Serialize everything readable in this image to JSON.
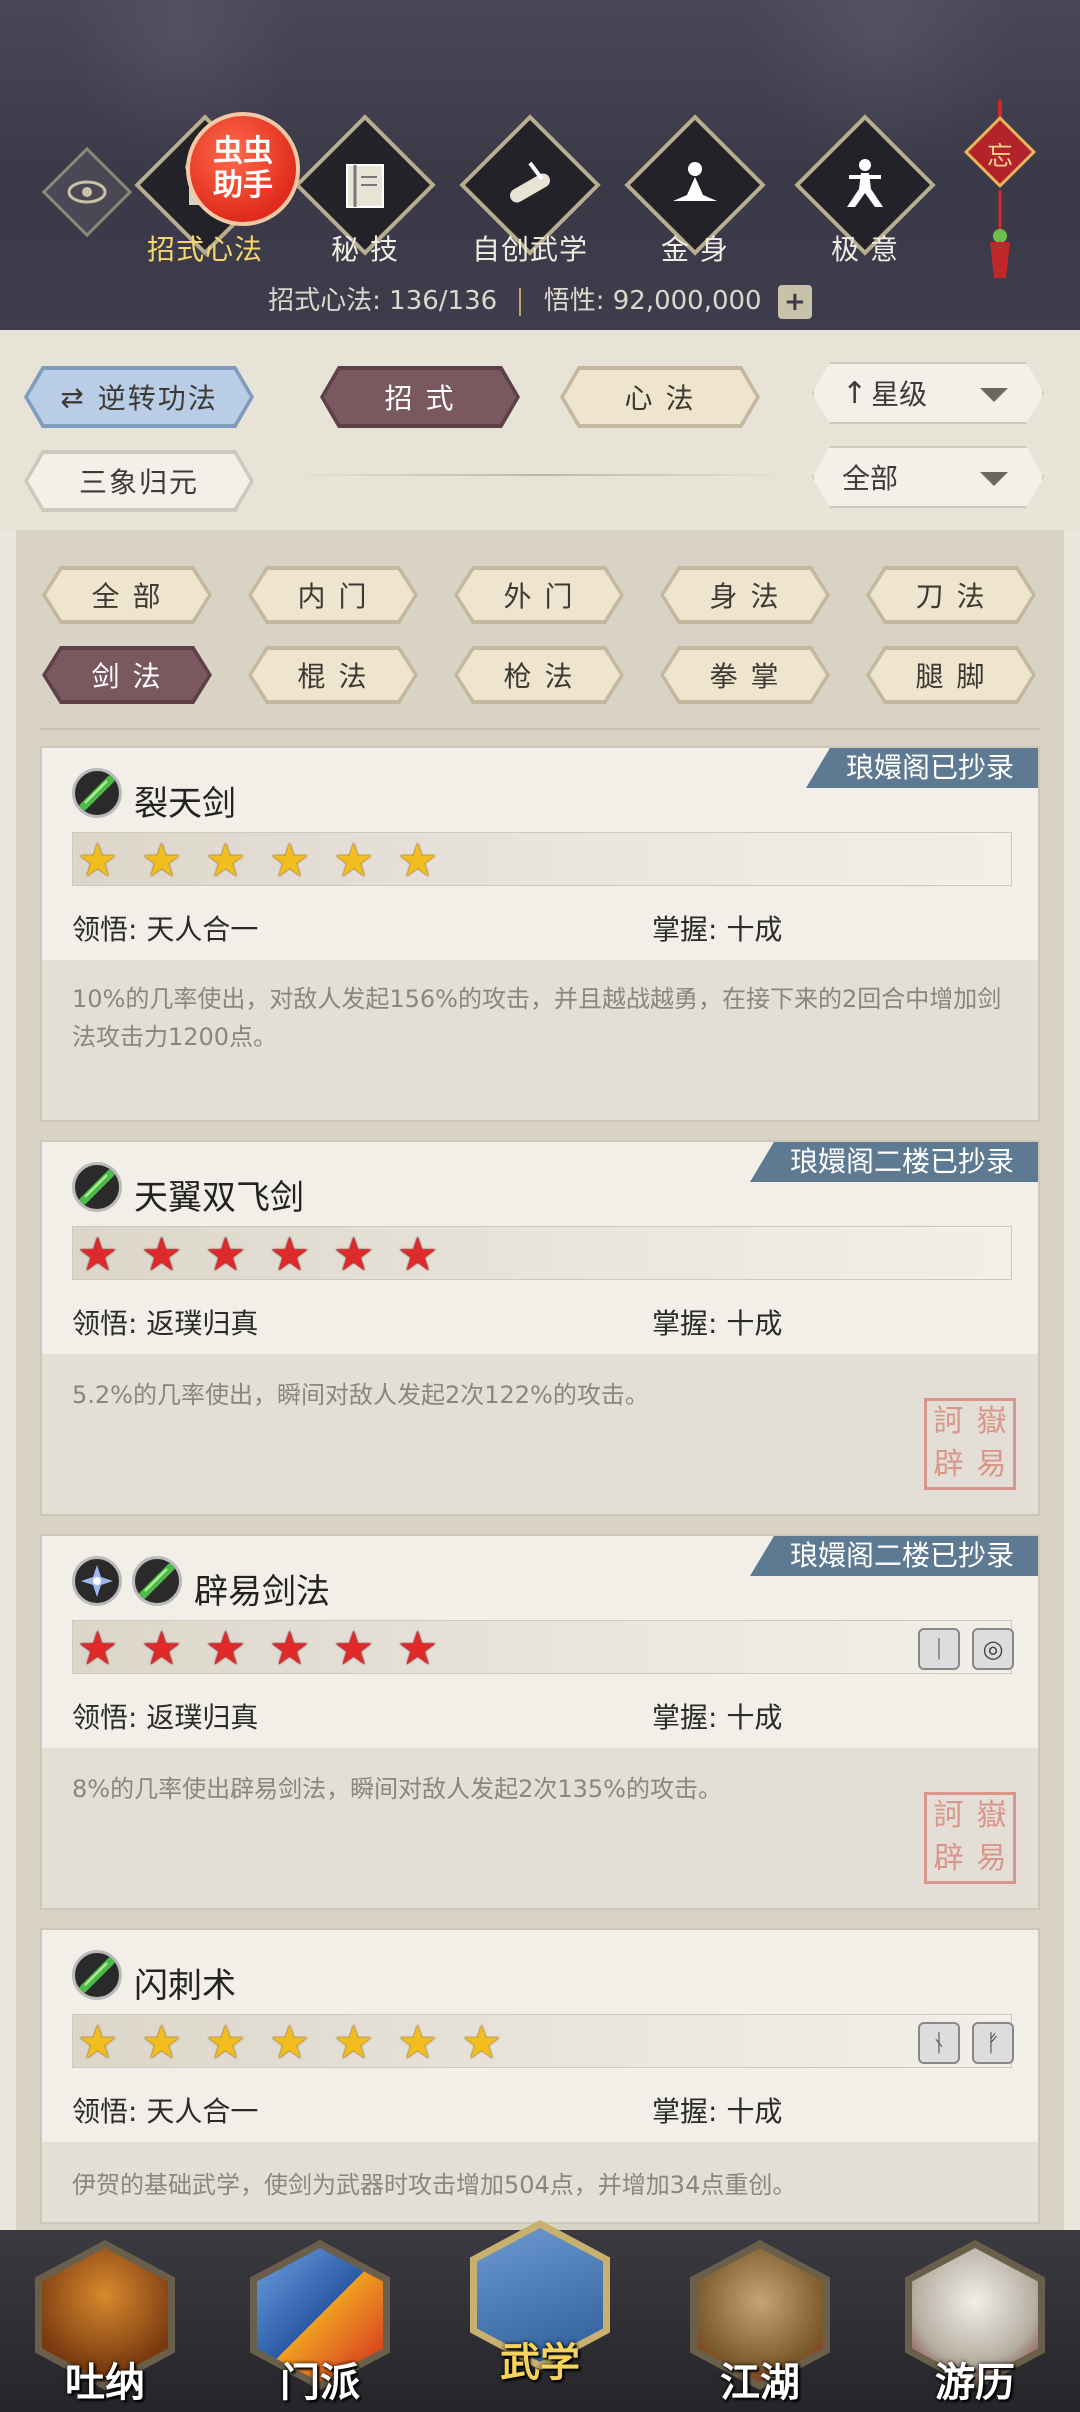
{
  "header": {
    "tabs": [
      {
        "label": "招式心法",
        "icon": "scroll-icon",
        "active": true
      },
      {
        "label": "秘 技",
        "icon": "book-icon"
      },
      {
        "label": "自创武学",
        "icon": "brush-scroll-icon"
      },
      {
        "label": "金 身",
        "icon": "meditation-icon"
      },
      {
        "label": "极 意",
        "icon": "martial-stance-icon"
      }
    ],
    "badge_text": "虫虫\n助手",
    "stats": {
      "skills_label": "招式心法:",
      "skills_value": "136/136",
      "insight_label": "悟性:",
      "insight_value": "92,000,000",
      "plus": "+"
    },
    "knot_char": "忘"
  },
  "toolbar": {
    "reverse_label": "逆转功法",
    "tab_moves": "招 式",
    "tab_mind": "心 法",
    "sort_select": "星级",
    "sanxiang_label": "三象归元",
    "filter_select": "全部"
  },
  "filters": {
    "row1": [
      "全 部",
      "内 门",
      "外 门",
      "身 法",
      "刀 法"
    ],
    "row2": [
      "剑 法",
      "棍 法",
      "枪 法",
      "拳 掌",
      "腿 脚"
    ],
    "active": "剑 法"
  },
  "cards": [
    {
      "title": "裂天剑",
      "tag": "琅嬛阁已抄录",
      "star_color": "gold",
      "stars": 6,
      "insight_label": "领悟:",
      "insight_value": "天人合一",
      "mastery_label": "掌握:",
      "mastery_value": "十成",
      "desc": "10%的几率使出，对敌人发起156%的攻击，并且越战越勇，在接下来的2回合中增加剑法攻击力1200点。"
    },
    {
      "title": "天翼双飞剑",
      "tag": "琅嬛阁二楼已抄录",
      "star_color": "red",
      "stars": 6,
      "insight_label": "领悟:",
      "insight_value": "返璞归真",
      "mastery_label": "掌握:",
      "mastery_value": "十成",
      "desc": "5.2%的几率使出，瞬间对敌人发起2次122%的攻击。",
      "seal": [
        "訶",
        "嶽",
        "辟",
        "易"
      ]
    },
    {
      "title": "辟易剑法",
      "tag": "琅嬛阁二楼已抄录",
      "star_color": "red",
      "stars": 6,
      "insight_label": "领悟:",
      "insight_value": "返璞归真",
      "mastery_label": "掌握:",
      "mastery_value": "十成",
      "desc": "8%的几率使出辟易剑法，瞬间对敌人发起2次135%的攻击。",
      "seal": [
        "訶",
        "嶽",
        "辟",
        "易"
      ]
    },
    {
      "title": "闪刺术",
      "star_color": "gold",
      "stars": 7,
      "insight_label": "领悟:",
      "insight_value": "天人合一",
      "mastery_label": "掌握:",
      "mastery_value": "十成",
      "desc": "伊贺的基础武学，使剑为武器时攻击增加504点，并增加34点重创。"
    }
  ],
  "bottom_nav": [
    {
      "label": "吐纳",
      "icon": "monk-icon"
    },
    {
      "label": "门派",
      "icon": "sect-flags-icon"
    },
    {
      "label": "武学",
      "icon": "martial-books-icon",
      "active": true
    },
    {
      "label": "江湖",
      "icon": "straw-hat-icon"
    },
    {
      "label": "游历",
      "icon": "white-horse-icon"
    }
  ]
}
